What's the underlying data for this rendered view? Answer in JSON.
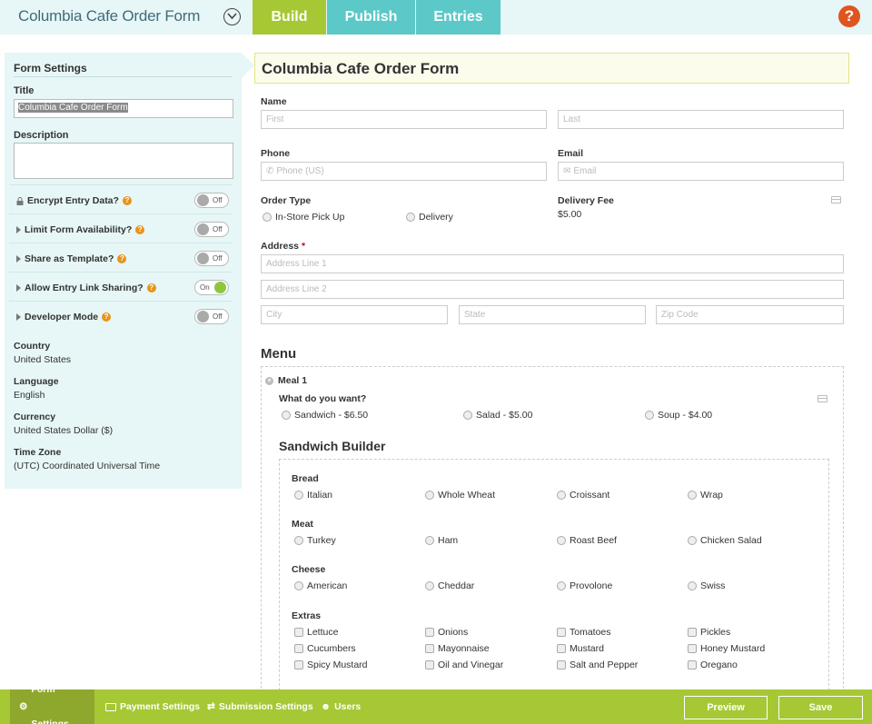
{
  "header": {
    "title": "Columbia Cafe Order Form",
    "tabs": [
      {
        "label": "Build"
      },
      {
        "label": "Publish"
      },
      {
        "label": "Entries"
      }
    ],
    "help_label": "?"
  },
  "settings": {
    "heading": "Form Settings",
    "title_label": "Title",
    "title_value": "Columbia Cafe Order Form",
    "description_label": "Description",
    "toggles": [
      {
        "label": "Encrypt Entry Data?",
        "state": "Off"
      },
      {
        "label": "Limit Form Availability?",
        "state": "Off"
      },
      {
        "label": "Share as Template?",
        "state": "Off"
      },
      {
        "label": "Allow Entry Link Sharing?",
        "state": "On"
      },
      {
        "label": "Developer Mode",
        "state": "Off"
      }
    ],
    "meta": [
      {
        "label": "Country",
        "value": "United States"
      },
      {
        "label": "Language",
        "value": "English"
      },
      {
        "label": "Currency",
        "value": "United States Dollar ($)"
      },
      {
        "label": "Time Zone",
        "value": "(UTC) Coordinated Universal Time"
      }
    ]
  },
  "form": {
    "title": "Columbia Cafe Order Form",
    "name_label": "Name",
    "first_placeholder": "First",
    "last_placeholder": "Last",
    "phone_label": "Phone",
    "phone_placeholder": "Phone (US)",
    "email_label": "Email",
    "email_placeholder": "Email",
    "order_type_label": "Order Type",
    "order_type_options": [
      "In-Store Pick Up",
      "Delivery"
    ],
    "delivery_fee_label": "Delivery Fee",
    "delivery_fee_value": "$5.00",
    "address_label": "Address",
    "required_mark": "*",
    "address_line1": "Address Line 1",
    "address_line2": "Address Line 2",
    "city": "City",
    "state": "State",
    "zip": "Zip Code",
    "menu_heading": "Menu",
    "meal_label": "Meal 1",
    "want_label": "What do you want?",
    "want_options": [
      "Sandwich - $6.50",
      "Salad - $5.00",
      "Soup - $4.00"
    ],
    "sandwich_builder": "Sandwich Builder",
    "bread_label": "Bread",
    "bread": [
      "Italian",
      "Whole Wheat",
      "Croissant",
      "Wrap"
    ],
    "meat_label": "Meat",
    "meat": [
      "Turkey",
      "Ham",
      "Roast Beef",
      "Chicken Salad"
    ],
    "cheese_label": "Cheese",
    "cheese": [
      "American",
      "Cheddar",
      "Provolone",
      "Swiss"
    ],
    "extras_label": "Extras",
    "extras": [
      "Lettuce",
      "Onions",
      "Tomatoes",
      "Pickles",
      "Cucumbers",
      "Mayonnaise",
      "Mustard",
      "Honey Mustard",
      "Spicy Mustard",
      "Oil and Vinegar",
      "Salt and Pepper",
      "Oregano"
    ]
  },
  "footer": {
    "form_settings": "Form Settings",
    "payment_settings": "Payment Settings",
    "submission_settings": "Submission Settings",
    "users": "Users",
    "preview": "Preview",
    "save": "Save"
  },
  "colors": {
    "accent_green": "#a6c834",
    "accent_teal": "#5cc8c8",
    "help_orange": "#e0541f",
    "panel_bg": "#e7f6f6"
  }
}
